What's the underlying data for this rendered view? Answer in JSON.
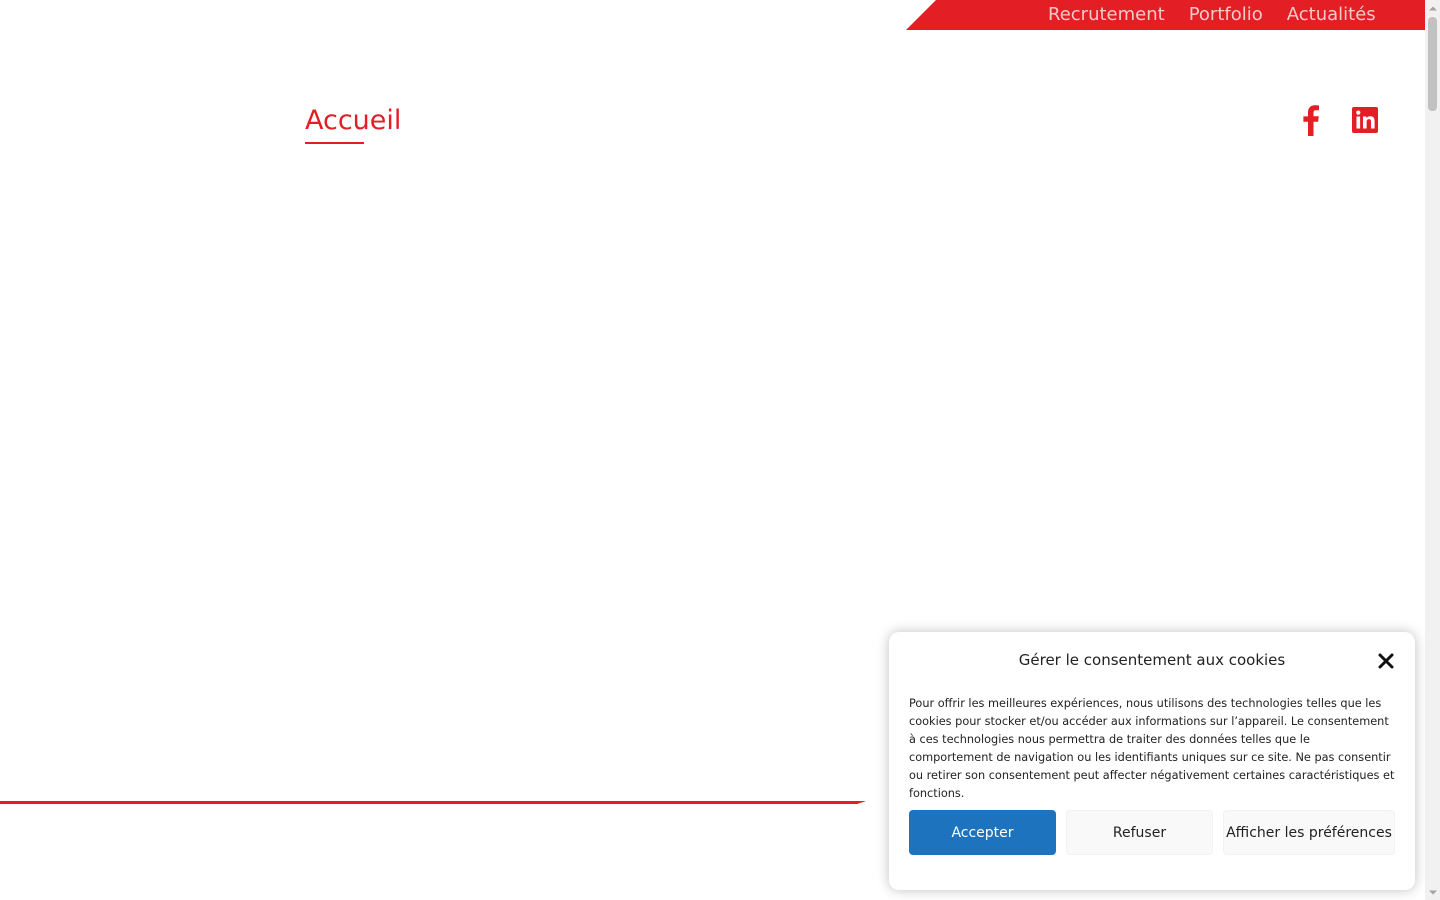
{
  "colors": {
    "brand_red": "#e31e24",
    "nav_link": "#f6c9ca",
    "accept_button": "#1e73be"
  },
  "top_nav": {
    "items": [
      {
        "label": "Recrutement"
      },
      {
        "label": "Portfolio"
      },
      {
        "label": "Actualités"
      }
    ]
  },
  "header": {
    "home_label": "Accueil",
    "social": [
      {
        "icon": "facebook-icon"
      },
      {
        "icon": "linkedin-icon"
      }
    ]
  },
  "cookie_banner": {
    "title": "Gérer le consentement aux cookies",
    "text": "Pour offrir les meilleures expériences, nous utilisons des technologies telles que les cookies pour stocker et/ou accéder aux informations sur l’appareil. Le consentement à ces technologies nous permettra de traiter des données telles que le comportement de navigation ou les identifiants uniques sur ce site. Ne pas consentir ou retirer son consentement peut affecter négativement certaines caractéristiques et fonctions.",
    "accept_label": "Accepter",
    "refuse_label": "Refuser",
    "preferences_label": "Afficher les préférences",
    "close_icon": "close-icon"
  }
}
